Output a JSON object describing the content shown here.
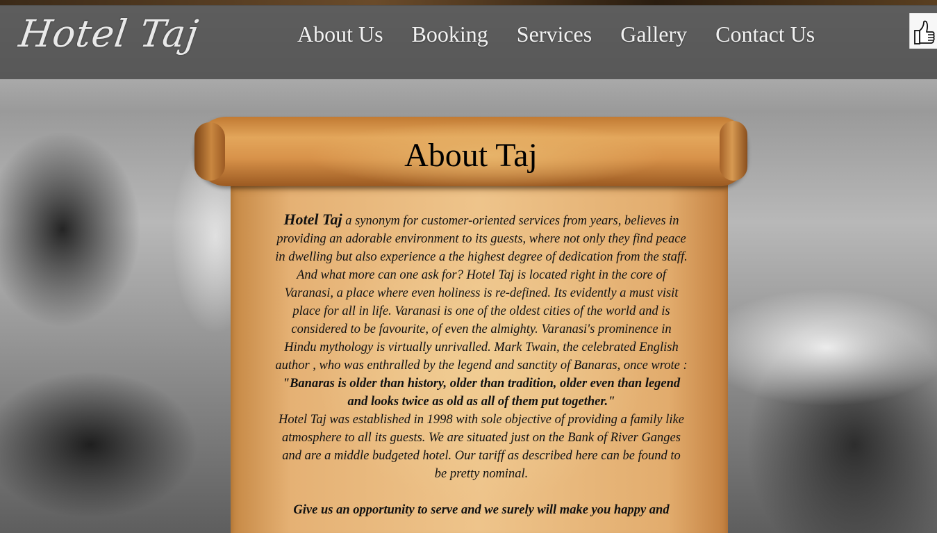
{
  "brand": {
    "logo_text": "Hotel Taj"
  },
  "nav": {
    "items": [
      "About Us",
      "Booking",
      "Services",
      "Gallery",
      "Contact Us"
    ]
  },
  "like_button": {
    "icon": "thumbs-up-icon"
  },
  "about": {
    "title": "About Taj",
    "brand_name": "Hotel Taj",
    "para1": "a synonym for customer-oriented services from years, believes in providing an adorable environment to its guests, where not only they find peace in dwelling but also experience a the highest degree of dedication from the staff. And what more can one ask for? Hotel Taj is located right in the core of Varanasi, a place where even holiness is re-defined. Its evidently a must visit place for all in life. Varanasi is one of the oldest cities of the world and is considered to be favourite, of even the almighty. Varanasi's prominence in Hindu mythology is virtually unrivalled. Mark Twain, the celebrated English author , who was enthralled by the legend and sanctity of Banaras, once wrote :",
    "quote": "\"Banaras is older than history, older than tradition, older even than legend and looks twice as old as all of them put together.\"",
    "para2": "Hotel Taj was established in 1998 with sole objective of providing a family like atmosphere to all its guests. We are situated just on the Bank of River Ganges and are a middle budgeted hotel. Our tariff as described here can be found to be pretty nominal.",
    "closing": "Give us an opportunity to serve and we surely will make you happy and"
  }
}
